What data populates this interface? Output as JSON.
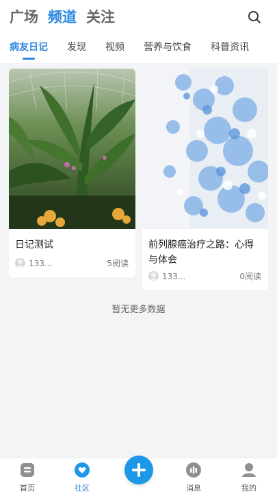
{
  "header": {
    "tabs": [
      {
        "label": "广场"
      },
      {
        "label": "频道"
      },
      {
        "label": "关注"
      }
    ],
    "search_icon": "search-icon"
  },
  "channel_tabs": [
    {
      "label": "病友日记"
    },
    {
      "label": "发现"
    },
    {
      "label": "视频"
    },
    {
      "label": "营养与饮食"
    },
    {
      "label": "科普资讯"
    }
  ],
  "posts": [
    {
      "title": "日记测试",
      "user": "133...",
      "reads": "5阅读",
      "image": "tropical-garden-photo"
    },
    {
      "title": "前列腺癌治疗之路：心得与体会",
      "user": "133...",
      "reads": "0阅读",
      "image": "blue-flowers-photo"
    }
  ],
  "feed": {
    "end_text": "暂无更多数据"
  },
  "tabbar": {
    "items": [
      {
        "label": "首页",
        "icon": "home-icon"
      },
      {
        "label": "社区",
        "icon": "community-icon"
      },
      {
        "label": "消息",
        "icon": "message-icon"
      },
      {
        "label": "我的",
        "icon": "profile-icon"
      }
    ],
    "fab_icon": "plus-icon"
  },
  "colors": {
    "accent": "#2b86e0",
    "fab": "#1d98e8",
    "background": "#f3f4f6"
  }
}
